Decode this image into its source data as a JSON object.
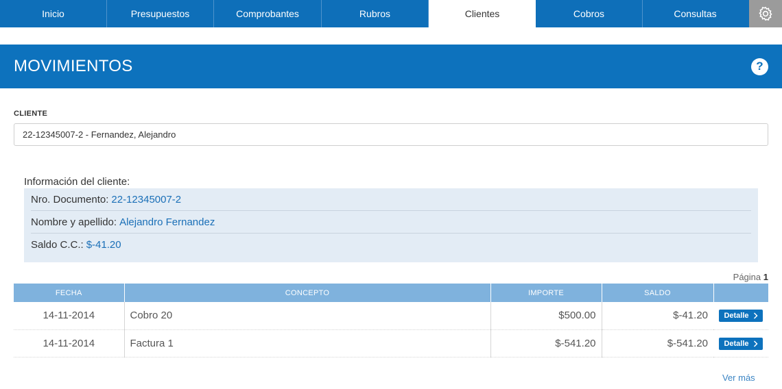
{
  "nav": {
    "tabs": [
      {
        "label": "Inicio"
      },
      {
        "label": "Presupuestos"
      },
      {
        "label": "Comprobantes"
      },
      {
        "label": "Rubros"
      },
      {
        "label": "Clientes"
      },
      {
        "label": "Cobros"
      },
      {
        "label": "Consultas"
      }
    ],
    "active_tab": "Clientes"
  },
  "header": {
    "title": "MOVIMIENTOS",
    "help_label": "?"
  },
  "cliente": {
    "label": "CLIENTE",
    "value": "22-12345007-2 - Fernandez, Alejandro"
  },
  "info": {
    "title": "Información del cliente:",
    "rows": [
      {
        "label": "Nro. Documento:",
        "value": "22-12345007-2"
      },
      {
        "label": "Nombre y apellido:",
        "value": "Alejandro Fernandez"
      },
      {
        "label": "Saldo C.C.:",
        "value": "$-41.20"
      }
    ]
  },
  "pagination": {
    "label": "Página",
    "current": "1"
  },
  "table": {
    "headers": [
      "FECHA",
      "CONCEPTO",
      "IMPORTE",
      "SALDO",
      ""
    ],
    "rows": [
      {
        "fecha": "14-11-2014",
        "concepto": "Cobro 20",
        "importe": "$500.00",
        "saldo": "$-41.20",
        "action": "Detalle"
      },
      {
        "fecha": "14-11-2014",
        "concepto": "Factura 1",
        "importe": "$-541.20",
        "saldo": "$-541.20",
        "action": "Detalle"
      }
    ]
  },
  "footer": {
    "ver_mas": "Ver más"
  },
  "colors": {
    "primary": "#0d72bd",
    "table_header": "#7fb2dd",
    "info_bg": "#e3ecf5",
    "link": "#1a6fb7"
  },
  "icons": {
    "settings": "gear-icon",
    "help": "help-icon",
    "detail_arrow": "chevron-right-icon"
  }
}
